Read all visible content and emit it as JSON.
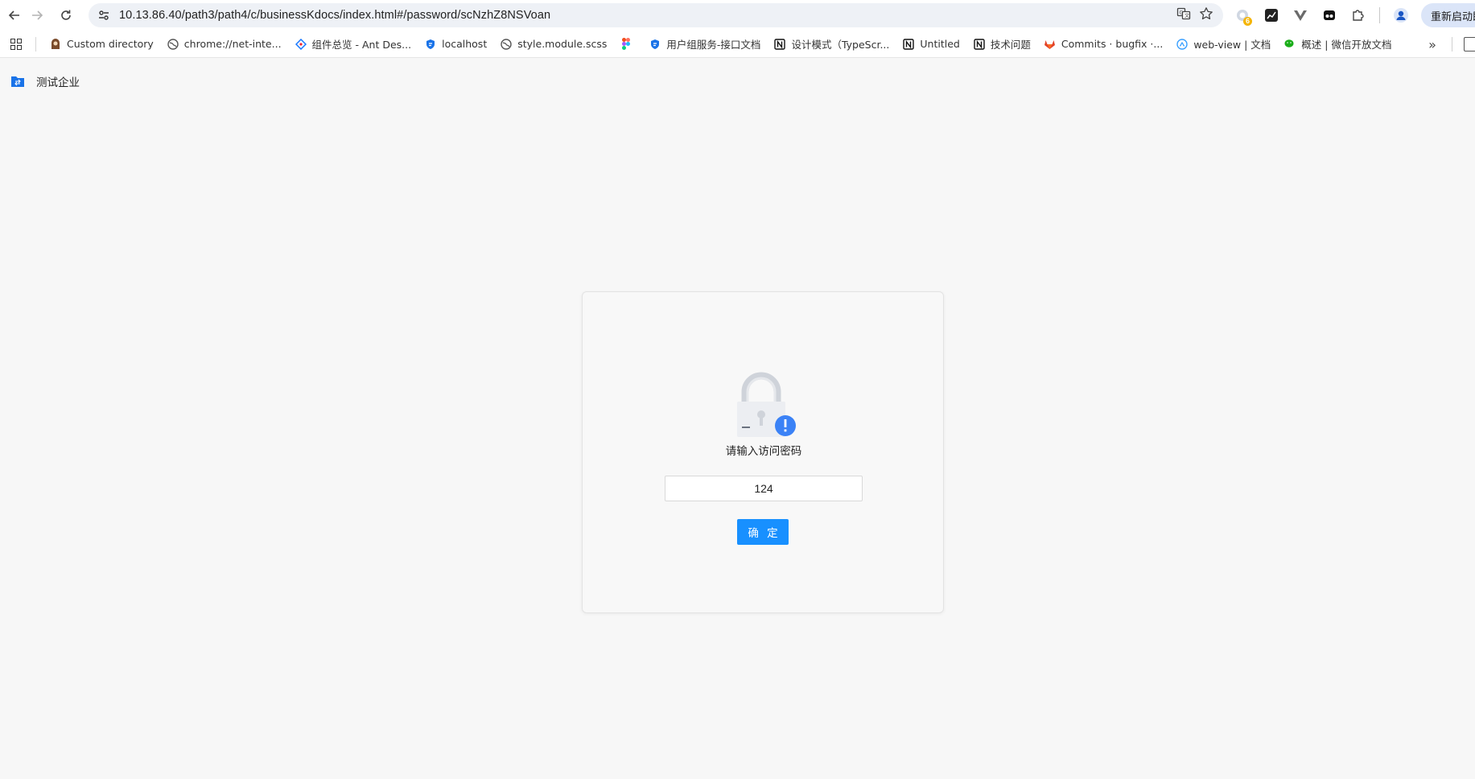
{
  "browser": {
    "url": "10.13.86.40/path3/path4/c/businessKdocs/index.html#/password/scNzhZ8NSVoan",
    "relaunch_label": "重新启动即可更新",
    "extension_badge": "6"
  },
  "bookmarks": [
    {
      "label": "Custom directory",
      "icon": "avatar-icon",
      "color": "#7a4a2a"
    },
    {
      "label": "chrome://net-inte...",
      "icon": "globe-icon",
      "color": "#555555"
    },
    {
      "label": "组件总览 - Ant Des...",
      "icon": "ant-design-icon",
      "color": "#1677ff"
    },
    {
      "label": "localhost",
      "icon": "shield-icon",
      "color": "#1a73e8"
    },
    {
      "label": "style.module.scss",
      "icon": "globe-icon",
      "color": "#555555"
    },
    {
      "label": "",
      "icon": "figma-icon",
      "color": "#f24e1e"
    },
    {
      "label": "用户组服务-接口文档",
      "icon": "shield-icon",
      "color": "#1a73e8"
    },
    {
      "label": "设计模式（TypeScr...",
      "icon": "notion-icon",
      "color": "#111111"
    },
    {
      "label": "Untitled",
      "icon": "notion-icon",
      "color": "#111111"
    },
    {
      "label": "技术问题",
      "icon": "notion-icon",
      "color": "#111111"
    },
    {
      "label": "Commits · bugfix ·...",
      "icon": "gitlab-icon",
      "color": "#e24329"
    },
    {
      "label": "web-view | 文档",
      "icon": "mini-program-icon",
      "color": "#3aa0ff"
    },
    {
      "label": "概述 | 微信开放文档",
      "icon": "wechat-icon",
      "color": "#1aad19"
    }
  ],
  "page": {
    "company_name": "测试企业",
    "prompt": "请输入访问密码",
    "password_value": "124",
    "confirm_label": "确 定"
  },
  "colors": {
    "accent": "#1890ff",
    "lock_badge": "#3b82f6"
  }
}
